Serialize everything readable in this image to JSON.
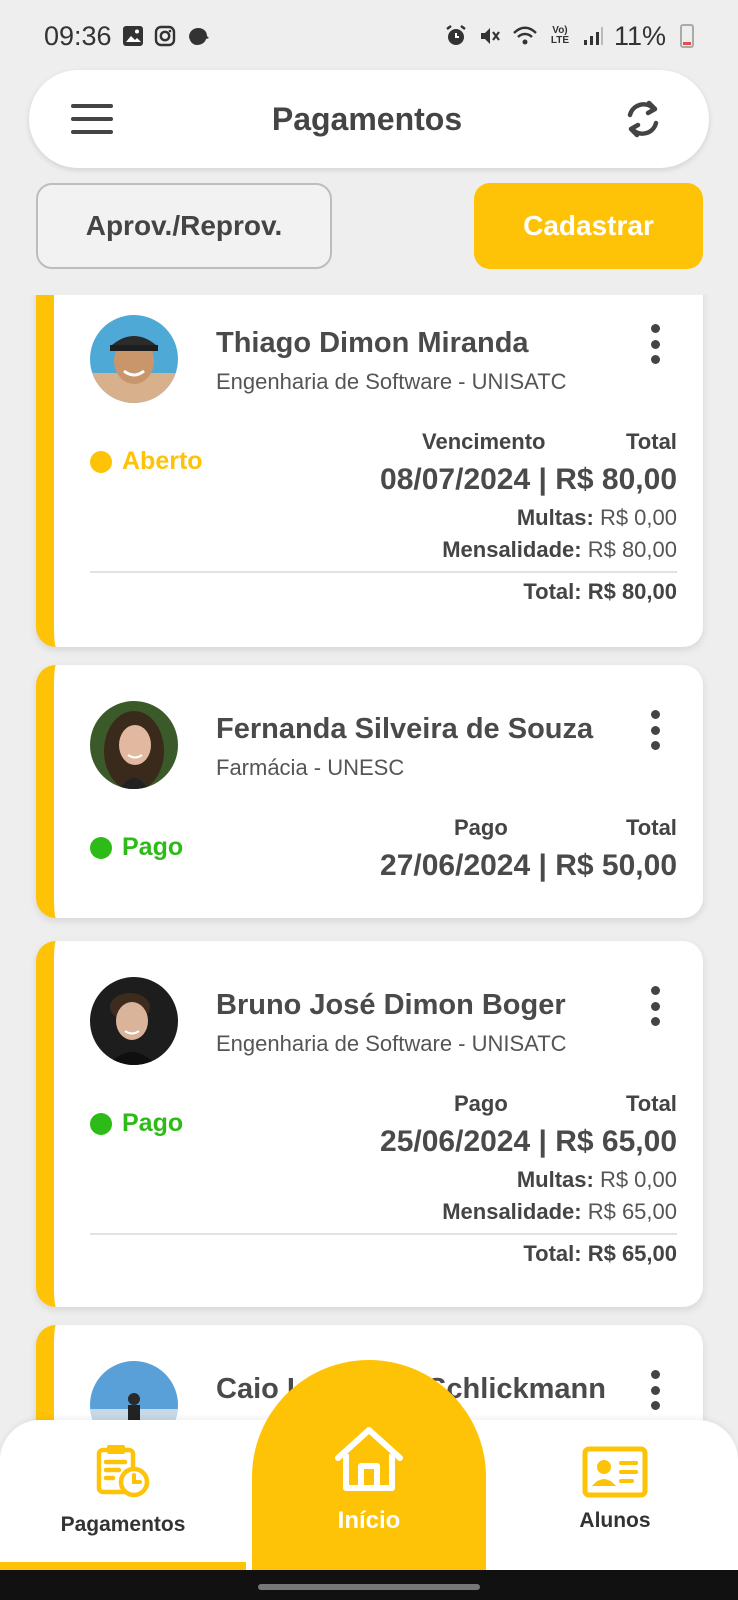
{
  "status_bar": {
    "time": "09:36",
    "battery": "11%",
    "left_icons": [
      "gallery-icon",
      "instagram-icon",
      "notification-icon"
    ],
    "right_icons": [
      "alarm-icon",
      "mute-icon",
      "wifi-icon",
      "volte-icon",
      "signal-icon",
      "battery-icon"
    ],
    "volte_text": "Vo) LTE"
  },
  "header": {
    "title": "Pagamentos",
    "menu_icon": "hamburger-menu-icon",
    "refresh_icon": "refresh-icon"
  },
  "actions": {
    "approve_label": "Aprov./Reprov.",
    "register_label": "Cadastrar"
  },
  "payments": [
    {
      "name": "Thiago Dimon Miranda",
      "course": "Engenharia de Software - UNISATC",
      "status": "Aberto",
      "status_color": "#fec307",
      "date_label": "Vencimento",
      "total_label": "Total",
      "amount": "08/07/2024 | R$ 80,00",
      "fines_label": "Multas:",
      "fines_value": "R$ 0,00",
      "fee_label": "Mensalidade:",
      "fee_value": "R$ 80,00",
      "sum_label": "Total:",
      "sum_value": "R$ 80,00"
    },
    {
      "name": "Fernanda Silveira de Souza",
      "course": "Farmácia - UNESC",
      "status": "Pago",
      "status_color": "#2dbb17",
      "date_label": "Pago",
      "total_label": "Total",
      "amount": "27/06/2024 | R$ 50,00"
    },
    {
      "name": "Bruno José Dimon Boger",
      "course": "Engenharia de Software - UNISATC",
      "status": "Pago",
      "status_color": "#2dbb17",
      "date_label": "Pago",
      "total_label": "Total",
      "amount": "25/06/2024 | R$ 65,00",
      "fines_label": "Multas:",
      "fines_value": "R$ 0,00",
      "fee_label": "Mensalidade:",
      "fee_value": "R$ 65,00",
      "sum_label": "Total:",
      "sum_value": "R$ 65,00"
    },
    {
      "name": "Caio Leonardo Schlickmann"
    }
  ],
  "bottom_nav": {
    "left_label": "Pagamentos",
    "center_label": "Início",
    "right_label": "Alunos",
    "active": "Pagamentos",
    "accent": "#fec307"
  }
}
